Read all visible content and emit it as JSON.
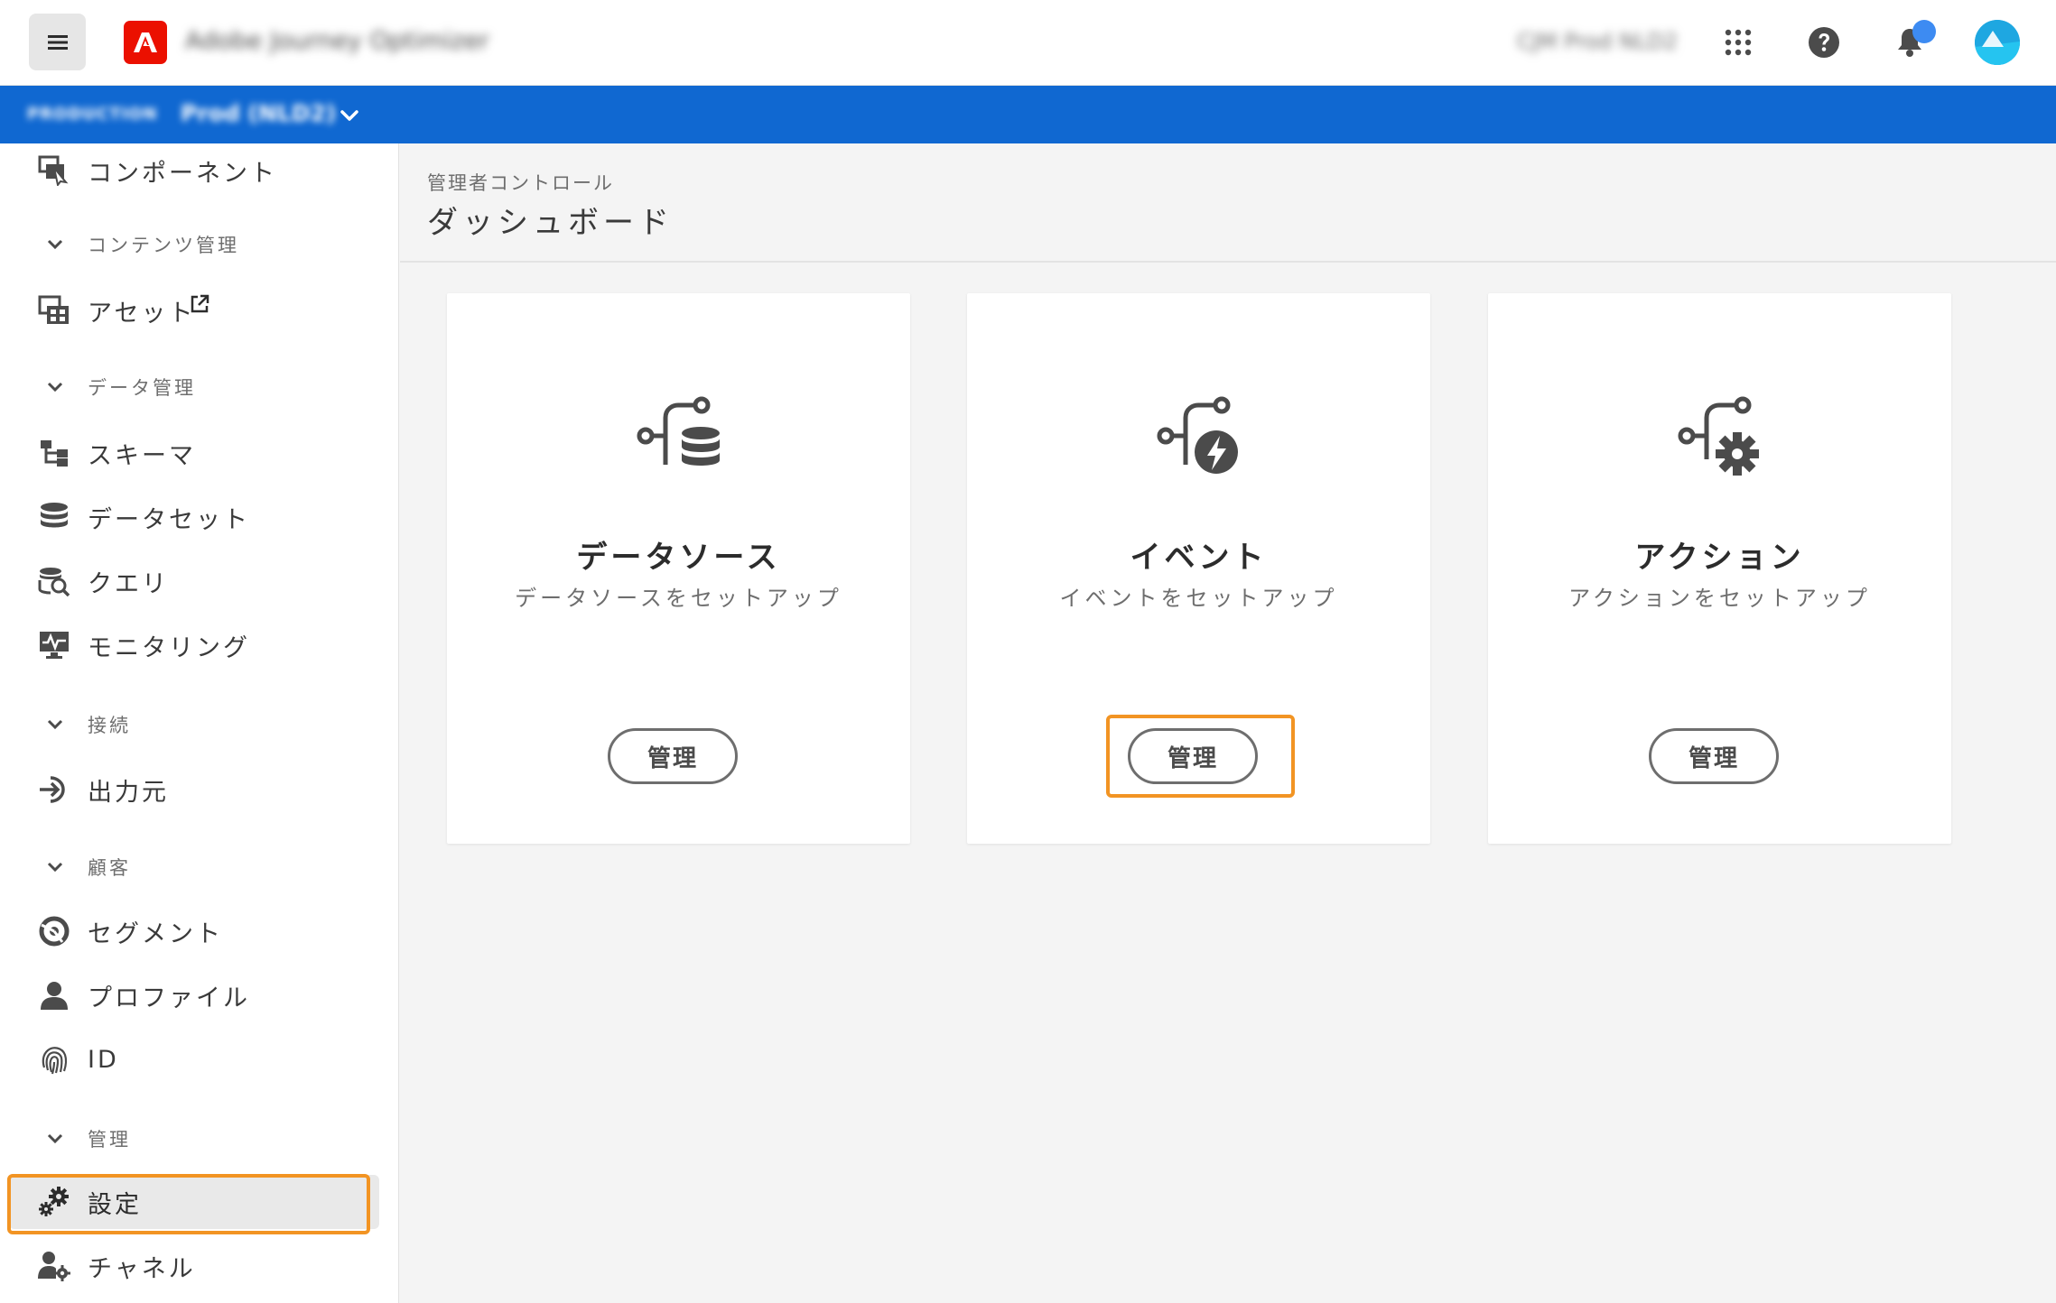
{
  "header": {
    "app_title": "Adobe Journey Optimizer",
    "org_name": "CJM Prod NLD2",
    "icons": [
      "menu-icon",
      "adobe-logo-icon",
      "apps-grid-icon",
      "help-icon",
      "bell-icon",
      "avatar"
    ]
  },
  "sandbox": {
    "type": "PRODUCTION",
    "name": "Prod (NLD2)"
  },
  "sidebar": {
    "items": [
      {
        "label": "コンポーネント",
        "icon": "components-icon"
      },
      {
        "section": "コンテンツ管理"
      },
      {
        "label": "アセット",
        "icon": "assets-icon",
        "external": true
      },
      {
        "section": "データ管理"
      },
      {
        "label": "スキーマ",
        "icon": "schema-icon"
      },
      {
        "label": "データセット",
        "icon": "dataset-icon"
      },
      {
        "label": "クエリ",
        "icon": "query-icon"
      },
      {
        "label": "モニタリング",
        "icon": "monitoring-icon"
      },
      {
        "section": "接続"
      },
      {
        "label": "出力元",
        "icon": "sources-icon"
      },
      {
        "section": "顧客"
      },
      {
        "label": "セグメント",
        "icon": "segment-icon"
      },
      {
        "label": "プロファイル",
        "icon": "profile-icon"
      },
      {
        "label": "ID",
        "icon": "identity-icon"
      },
      {
        "section": "管理"
      },
      {
        "label": "設定",
        "icon": "settings-icon",
        "selected": true
      },
      {
        "label": "チャネル",
        "icon": "channel-icon"
      }
    ]
  },
  "main": {
    "breadcrumb": "管理者コントロール",
    "title": "ダッシュボード",
    "cards": [
      {
        "title": "データソース",
        "subtitle": "データソースをセットアップ",
        "button": "管理",
        "icon": "datasource-icon"
      },
      {
        "title": "イベント",
        "subtitle": "イベントをセットアップ",
        "button": "管理",
        "icon": "event-icon",
        "highlighted": true
      },
      {
        "title": "アクション",
        "subtitle": "アクションをセットアップ",
        "button": "管理",
        "icon": "action-icon"
      }
    ]
  },
  "colors": {
    "accent_blue": "#1068d1",
    "highlight_orange": "#f29423",
    "adobe_red": "#eb1000"
  }
}
